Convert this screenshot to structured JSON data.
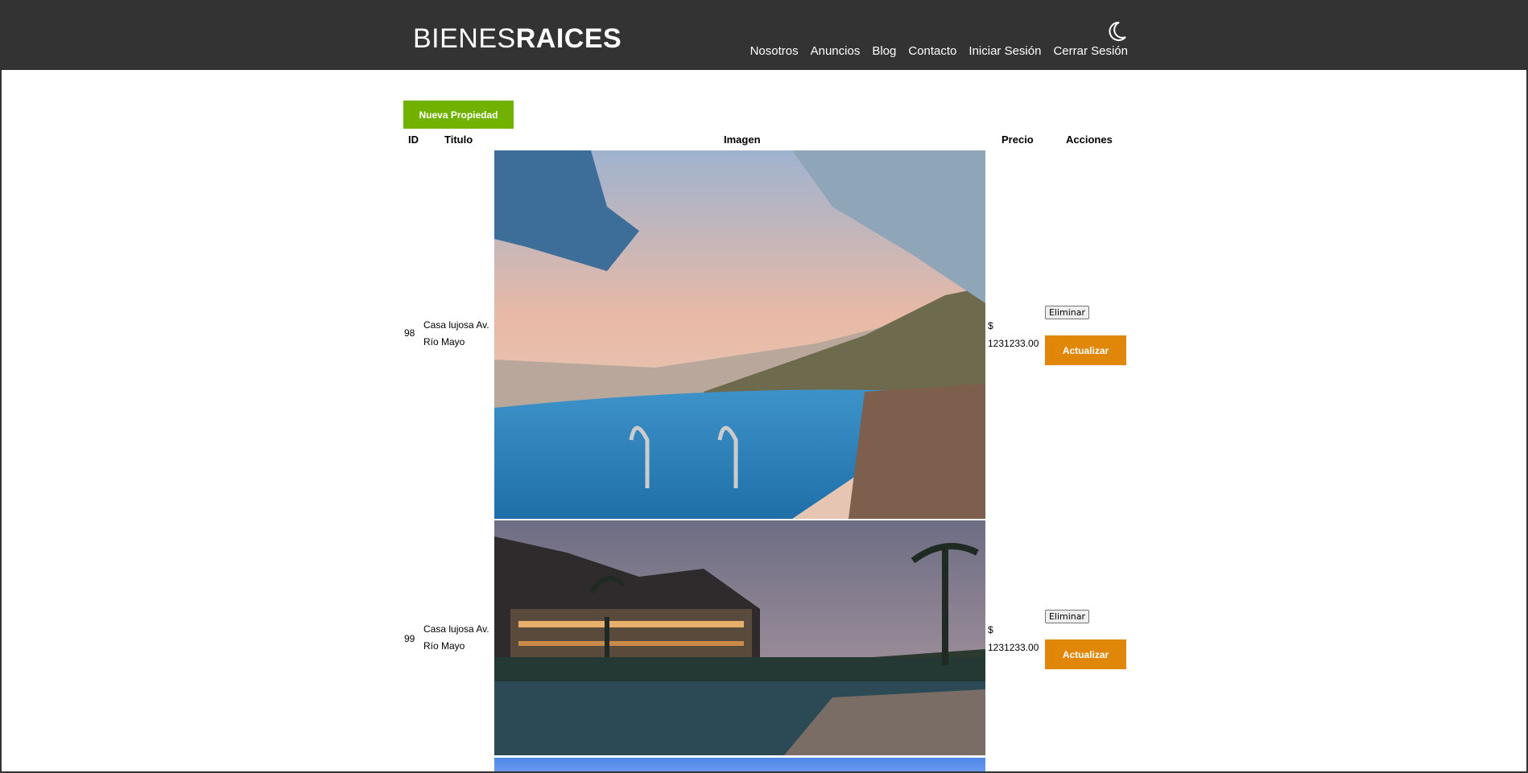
{
  "header": {
    "logo_light": "BIENES",
    "logo_bold": "RAICES",
    "nav": [
      "Nosotros",
      "Anuncios",
      "Blog",
      "Contacto",
      "Iniciar Sesión",
      "Cerrar Sesión"
    ]
  },
  "actions": {
    "new_property": "Nueva Propiedad"
  },
  "table": {
    "headers": {
      "id": "ID",
      "title": "Titulo",
      "image": "Imagen",
      "price": "Precio",
      "actions": "Acciones"
    },
    "rows": [
      {
        "id": "98",
        "title": "Casa lujosa Av. Río Mayo",
        "price": "$ 1231233.00",
        "delete": "Eliminar",
        "update": "Actualizar"
      },
      {
        "id": "99",
        "title": "Casa lujosa Av. Río Mayo",
        "price": "$ 1231233.00",
        "delete": "Eliminar",
        "update": "Actualizar"
      }
    ]
  },
  "colors": {
    "header_bg": "#333333",
    "primary_green": "#71b100",
    "update_orange": "#e08709"
  }
}
